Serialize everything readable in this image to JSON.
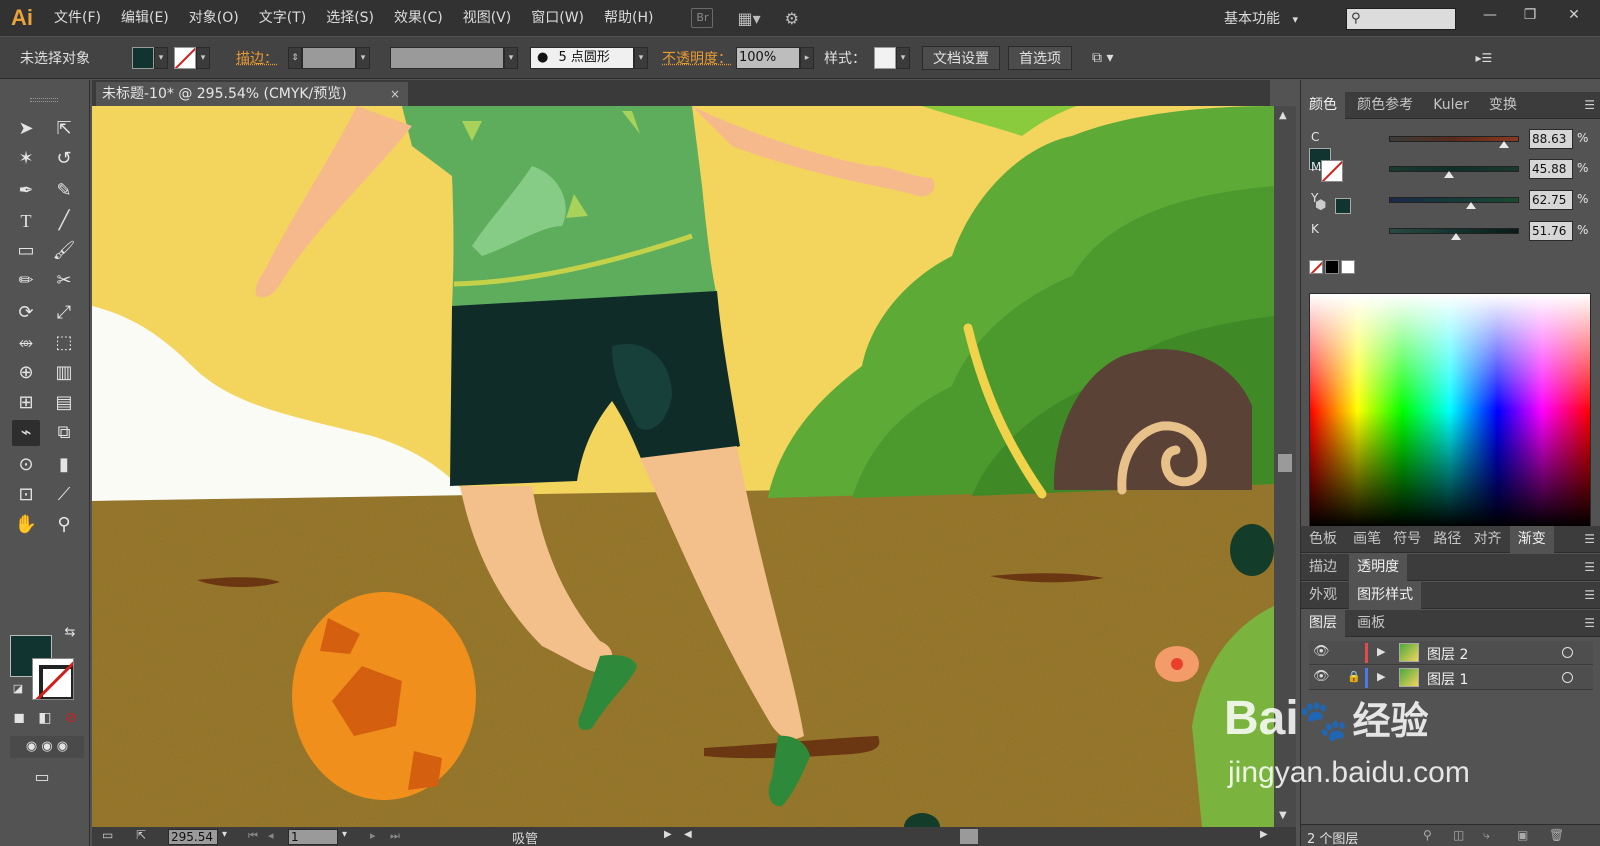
{
  "app": {
    "logo": "Ai"
  },
  "menu": [
    "文件(F)",
    "编辑(E)",
    "对象(O)",
    "文字(T)",
    "选择(S)",
    "效果(C)",
    "视图(V)",
    "窗口(W)",
    "帮助(H)"
  ],
  "menubar": {
    "bridge_chip": "Br",
    "workspace": "基本功能",
    "workspace_arrow": "▾",
    "search_glyph": "⚲",
    "win_min": "—",
    "win_max": "❐",
    "win_close": "✕"
  },
  "control": {
    "selection_status": "未选择对象",
    "stroke_label": "描边：",
    "brush": "5 点圆形",
    "opacity_label": "不透明度：",
    "opacity_value": "100%",
    "style_label": "样式：",
    "doc_setup": "文档设置",
    "preferences": "首选项"
  },
  "document_tab": {
    "title": "未标题-10* @ 295.54% (CMYK/预览)",
    "close": "×"
  },
  "status": {
    "zoom": "295.54",
    "artboard": "1",
    "tool_name": "吸管"
  },
  "color_panel": {
    "tabs": [
      "颜色",
      "颜色参考",
      "Kuler",
      "变换"
    ],
    "active_tab": "颜色",
    "menu": "☰",
    "channels": [
      {
        "label": "C",
        "value": "88.63",
        "fraction": 0.8863,
        "from": "#3b3b3b",
        "to": "#8a3a20",
        "track": "#5a2a1a"
      },
      {
        "label": "M",
        "value": "45.88",
        "fraction": 0.4588,
        "from": "#1a3a30",
        "to": "#1a3a30",
        "track": "#0f2f2a"
      },
      {
        "label": "Y",
        "value": "62.75",
        "fraction": 0.6275,
        "from": "#1b2a4a",
        "to": "#1a4a30",
        "track": "#163a3a"
      },
      {
        "label": "K",
        "value": "51.76",
        "fraction": 0.5176,
        "from": "#2a4a44",
        "to": "#0a1a18",
        "track": "#133430"
      }
    ],
    "pct": "%",
    "current_fill": "#123430"
  },
  "panel_groups": [
    {
      "tabs": [
        "色板",
        "画笔",
        "符号",
        "路径",
        "对齐",
        "渐变"
      ],
      "active": "渐变"
    },
    {
      "tabs": [
        "描边",
        "透明度"
      ],
      "active": "透明度"
    },
    {
      "tabs": [
        "外观",
        "图形样式"
      ],
      "active": "图形样式"
    },
    {
      "tabs": [
        "图层",
        "画板"
      ],
      "active": "图层"
    }
  ],
  "layers": {
    "items": [
      {
        "name": "图层 2",
        "color": "#e54a4a"
      },
      {
        "name": "图层 1",
        "color": "#4a7ae5"
      }
    ],
    "count_label": "2 个图层"
  },
  "watermark": {
    "brand": "Bai",
    "brand_cn": "经验",
    "url": "jingyan.baidu.com"
  }
}
